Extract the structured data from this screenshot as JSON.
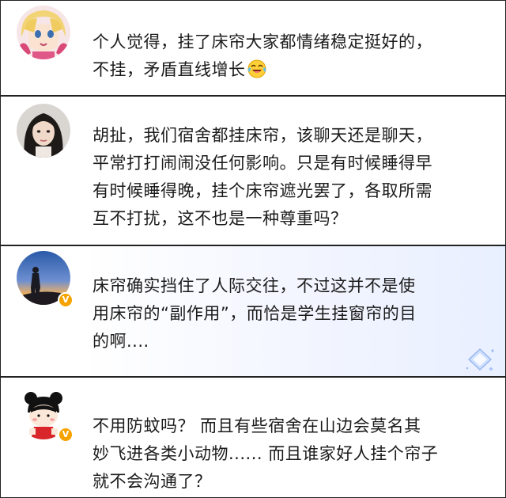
{
  "comments": [
    {
      "avatar": "anime-blonde-girl-avatar",
      "lines": [
        "个人觉得，挂了床帘大家都情绪稳定挺好的，",
        "不挂，矛盾直线增长"
      ],
      "trailing_emoji": "laughing-crying-emoji"
    },
    {
      "avatar": "woman-photo-avatar",
      "lines": [
        "胡扯，我们宿舍都挂床帘，该聊天还是聊天，",
        "平常打打闹闹没任何影响。只是有时候睡得早",
        "有时候睡得晚，挂个床帘遮光罢了，各取所需",
        "互不打扰，这不也是一种尊重吗？"
      ]
    },
    {
      "avatar": "sunset-silhouette-avatar",
      "verified_badge": "V",
      "highlighted": true,
      "lines": [
        "床帘确实挡住了人际交往，不过这并不是使",
        "用床帘的“副作用”，而恰是学生挂窗帘的目",
        "的啊...."
      ],
      "decoration": "diamond-sparkle-icon"
    },
    {
      "avatar": "cartoon-pucca-avatar",
      "verified_badge": "V",
      "lines": [
        "不用防蚊吗？ 而且有些宿舍在山边会莫名其",
        "妙飞进各类小动物...... 而且谁家好人挂个帘子",
        "就不会沟通了？"
      ]
    }
  ],
  "colors": {
    "text": "#1b1b1b",
    "badge": "#f5a300",
    "highlight": "#e8efff",
    "border": "#222222"
  }
}
